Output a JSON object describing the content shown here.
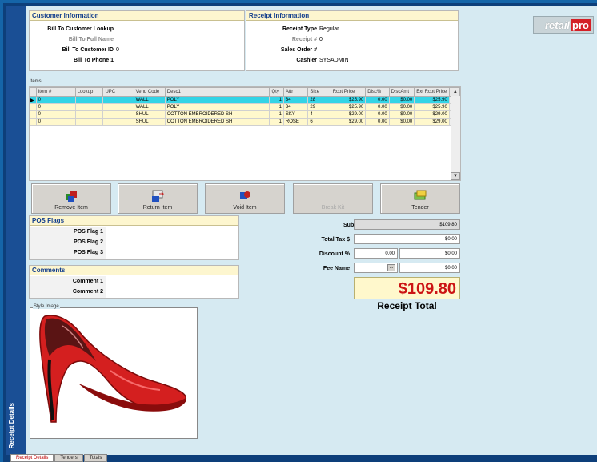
{
  "logo": {
    "text_a": "retail",
    "text_b": "pro"
  },
  "customer": {
    "title": "Customer Information",
    "fields": [
      {
        "label": "Bill To Customer Lookup",
        "value": ""
      },
      {
        "label": "Bill To Full Name",
        "value": ""
      },
      {
        "label": "Bill To Customer ID",
        "value": "0"
      },
      {
        "label": "Bill To Phone 1",
        "value": ""
      }
    ]
  },
  "receipt": {
    "title": "Receipt Information",
    "fields": [
      {
        "label": "Receipt Type",
        "value": "Regular"
      },
      {
        "label": "Receipt #",
        "value": "0"
      },
      {
        "label": "Sales Order #",
        "value": ""
      },
      {
        "label": "Cashier",
        "value": "SYSADMIN"
      }
    ]
  },
  "items": {
    "title": "Items",
    "columns": [
      "Item #",
      "Lookup",
      "UPC",
      "Vend Code",
      "Desc1",
      "Qty",
      "Attr",
      "Size",
      "Rcpt Price",
      "Disc%",
      "DiscAmt",
      "Ext Rcpt Price"
    ],
    "rows": [
      [
        "0",
        "",
        "",
        "WALL",
        "POLY",
        "1",
        "34",
        "28",
        "$25.90",
        "0.00",
        "$0.00",
        "$25.90"
      ],
      [
        "0",
        "",
        "",
        "WALL",
        "POLY",
        "1",
        "34",
        "29",
        "$25.90",
        "0.00",
        "$0.00",
        "$25.90"
      ],
      [
        "0",
        "",
        "",
        "SHUL",
        "COTTON EMBROIDERED SH",
        "1",
        "SKY",
        "4",
        "$29.00",
        "0.00",
        "$0.00",
        "$29.00"
      ],
      [
        "0",
        "",
        "",
        "SHUL",
        "COTTON EMBROIDERED SH",
        "1",
        "ROSE",
        "6",
        "$29.00",
        "0.00",
        "$0.00",
        "$29.00"
      ]
    ]
  },
  "buttons": {
    "remove": "Remove Item",
    "return": "Return Item",
    "void": "Void Item",
    "break_kit": "Break Kit",
    "tender": "Tender"
  },
  "pos_flags": {
    "title": "POS Flags",
    "labels": [
      "POS Flag 1",
      "POS Flag 2",
      "POS Flag 3"
    ]
  },
  "comments": {
    "title": "Comments",
    "labels": [
      "Comment 1",
      "Comment 2"
    ]
  },
  "totals": {
    "subtotal_label": "Subtotal",
    "subtotal_value": "$109.80",
    "tax_label": "Total Tax $",
    "tax_value": "$0.00",
    "discount_label": "Discount %",
    "discount_pct": "0.00",
    "discount_value": "$0.00",
    "fee_label": "Fee Name",
    "fee_btn": "...",
    "fee_value": "$0.00",
    "receipt_total": "$109.80",
    "receipt_total_label": "Receipt Total"
  },
  "style_image": {
    "title": "Style Image"
  },
  "sidebar": {
    "label": "Receipt Details"
  },
  "tabs": [
    "Receipt Details",
    "Tenders",
    "Totals"
  ],
  "colors": {
    "accent_red": "#cc1414",
    "header_blue": "#103c8c",
    "selected_row": "#33d4e6"
  }
}
